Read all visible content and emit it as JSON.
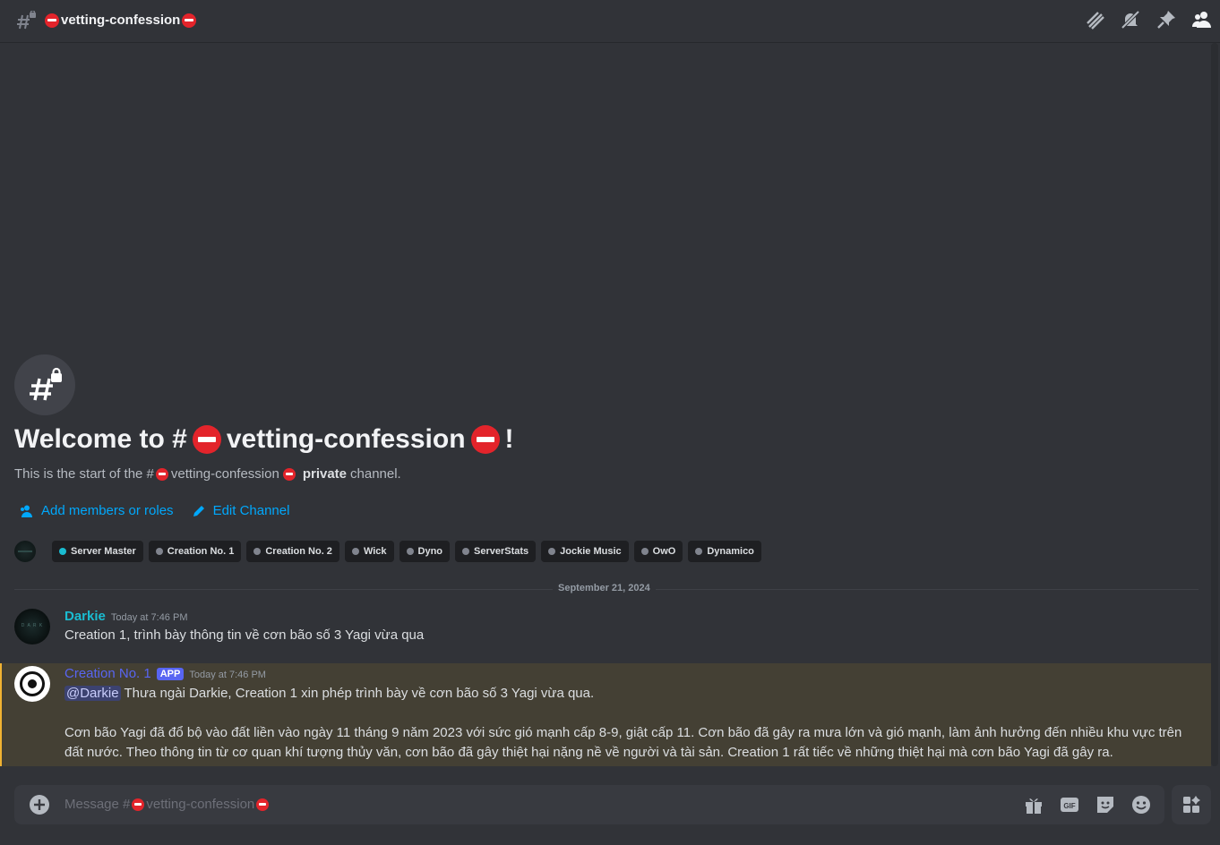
{
  "header": {
    "channel_name": "vetting-confession",
    "icons": [
      "threads-icon",
      "notification-muted-icon",
      "pin-icon",
      "member-list-icon"
    ]
  },
  "welcome": {
    "title_prefix": "Welcome to #",
    "title_channel": "vetting-confession",
    "title_suffix": "!",
    "subtitle_prefix": "This is the start of the #",
    "subtitle_channel": "vetting-confession",
    "subtitle_private": "private",
    "subtitle_suffix": "channel.",
    "add_members_label": "Add members or roles",
    "edit_channel_label": "Edit Channel"
  },
  "roles": [
    {
      "label": "Server Master",
      "color": "#1abcd1"
    },
    {
      "label": "Creation No. 1",
      "color": "#80848e"
    },
    {
      "label": "Creation No. 2",
      "color": "#80848e"
    },
    {
      "label": "Wick",
      "color": "#80848e"
    },
    {
      "label": "Dyno",
      "color": "#80848e"
    },
    {
      "label": "ServerStats",
      "color": "#80848e"
    },
    {
      "label": "Jockie Music",
      "color": "#80848e"
    },
    {
      "label": "OwO",
      "color": "#80848e"
    },
    {
      "label": "Dynamico",
      "color": "#80848e"
    }
  ],
  "date_divider": "September 21, 2024",
  "messages": [
    {
      "author": "Darkie",
      "timestamp": "Today at 7:46 PM",
      "text": "Creation 1, trình bày thông tin về cơn bão số 3 Yagi vừa qua"
    },
    {
      "author": "Creation No. 1",
      "tag": "APP",
      "timestamp": "Today at 7:46 PM",
      "mention": "@Darkie",
      "line1": "Thưa ngài Darkie, Creation 1 xin phép trình bày về cơn bão số 3 Yagi vừa qua.",
      "line2": "Cơn bão Yagi đã đổ bộ vào đất liền vào ngày 11 tháng 9 năm 2023 với sức gió mạnh cấp 8-9, giật cấp 11. Cơn bão đã gây ra mưa lớn và gió mạnh, làm ảnh hưởng đến nhiều khu vực trên",
      "line3": "đất nước. Theo thông tin từ cơ quan khí tượng thủy văn, cơn bão đã gây thiệt hại nặng nề về người và tài sản. Creation 1 rất tiếc về những thiệt hại mà cơn bão Yagi đã gây ra."
    }
  ],
  "composer": {
    "placeholder_prefix": "Message #",
    "placeholder_channel": "vetting-confession",
    "icons": [
      "add-attachment-icon",
      "gift-icon",
      "gif-icon",
      "sticker-icon",
      "emoji-icon",
      "apps-icon"
    ]
  },
  "colors": {
    "background": "#313338",
    "link": "#00a8fc",
    "darkie_name": "#1abcd1",
    "bot_name": "#5865f2",
    "highlight_bg": "#444034",
    "highlight_border": "#f0b232"
  }
}
